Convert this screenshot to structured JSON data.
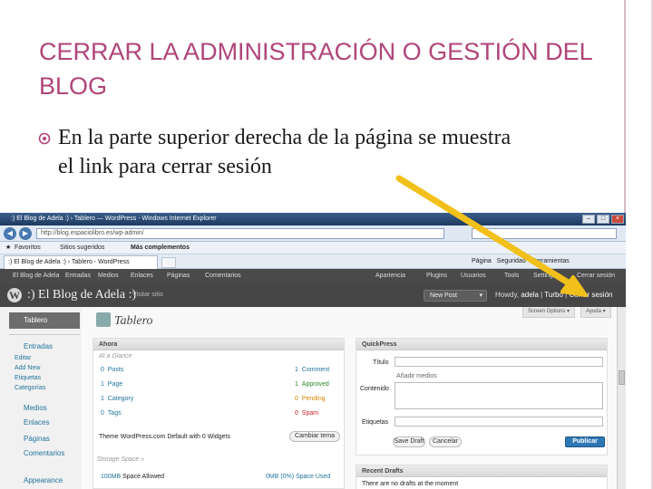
{
  "slide": {
    "title": "CERRAR LA ADMINISTRACIÓN O GESTIÓN DEL BLOG",
    "bullet_line1": "En la parte superior derecha de la página se muestra",
    "bullet_line2": "el link para cerrar sesión",
    "accent_color": "#b0457a",
    "arrow_color": "#f2c01a"
  },
  "browser": {
    "window_title": ":) El Blog de Adela :) › Tablero — WordPress - Windows Internet Explorer",
    "url": "http://blog.espaciolibro.es/wp-admin/",
    "favorites": {
      "favoritos": "Favoritos",
      "sitios": "Sitios sugeridos",
      "complementos": "Más complementos"
    },
    "tab_title": ":) El Blog de Adela :) › Tablero - WordPress",
    "commands": [
      "Página",
      "Seguridad",
      "Herramientas"
    ]
  },
  "wp": {
    "admin_bar": [
      "El Blog de Adela",
      "Entradas",
      "Medios",
      "Enlaces",
      "Páginas",
      "Comentarios",
      "Apariencia",
      "Plugins",
      "Usuarios",
      "Tools",
      "Settings",
      "Cerrar sesión"
    ],
    "blog_name": ":) El Blog de Adela :)",
    "visit_site": "Visitar sitio",
    "new_post": "New Post",
    "howdy_prefix": "Howdy,",
    "howdy_user": "adela",
    "howdy_sep": "|",
    "turbo": "Turbo",
    "logout": "Cerrar sesión",
    "page_title": "Tablero",
    "screen_options": "Screen Options ▾",
    "help": "Ayuda ▾",
    "menu": {
      "dashboard": "Tablero",
      "posts": "Entradas",
      "posts_sub": [
        "Editar",
        "Add New",
        "Etiquetas",
        "Categorías"
      ],
      "media": "Medios",
      "links": "Enlaces",
      "pages": "Páginas",
      "comments": "Comentarios",
      "appearance": "Appearance"
    },
    "right_now": {
      "title": "Ahora",
      "subtitle": "At a Glance",
      "left": [
        {
          "num": "0",
          "label": "Posts"
        },
        {
          "num": "1",
          "label": "Page"
        },
        {
          "num": "1",
          "label": "Category"
        },
        {
          "num": "0",
          "label": "Tags"
        }
      ],
      "right": [
        {
          "num": "1",
          "label": "Comment"
        },
        {
          "num": "1",
          "label": "Approved"
        },
        {
          "num": "0",
          "label": "Pending"
        },
        {
          "num": "0",
          "label": "Spam"
        }
      ],
      "theme_note": "Theme WordPress.com Default with 0 Widgets",
      "change_theme": "Cambiar tema",
      "storage_title": "Storage Space »",
      "storage_allowed": "100MB",
      "storage_allowed_label": "Space Allowed",
      "storage_used": "0MB (0%)",
      "storage_used_label": "Space Used"
    },
    "quickpress": {
      "title": "QuickPress",
      "title_label": "Título",
      "add_media": "Añadir medios",
      "content_label": "Contenido",
      "tags_label": "Etiquetas",
      "save_draft": "Save Draft",
      "cancel": "Cancelar",
      "publish": "Publicar"
    },
    "recent_drafts": {
      "title": "Recent Drafts",
      "empty": "There are no drafts at the moment"
    }
  }
}
